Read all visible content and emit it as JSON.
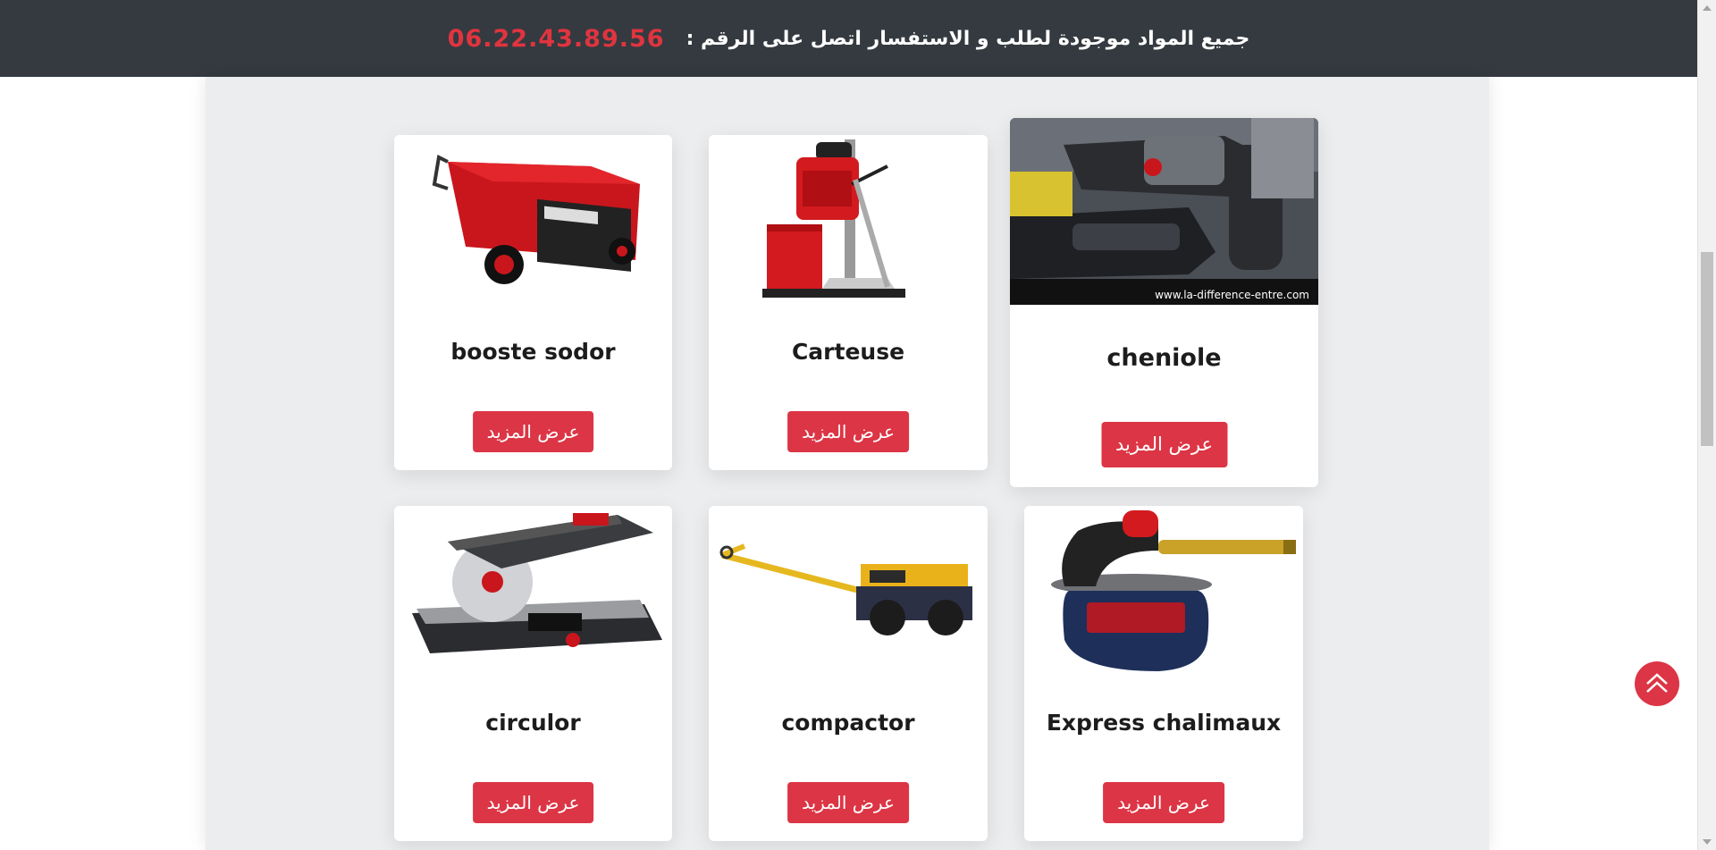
{
  "topbar": {
    "message": "جميع المواد موجودة لطلب و الاستفسار اتصل على الرقم :",
    "phone": "06.22.43.89.56"
  },
  "products": [
    {
      "title": "booste sodor",
      "button": "عرض المزيد",
      "image_icon": "welder-icon"
    },
    {
      "title": "Carteuse",
      "button": "عرض المزيد",
      "image_icon": "core-drill-icon"
    },
    {
      "title": "cheniole",
      "button": "عرض المزيد",
      "image_icon": "power-drills-photo",
      "image_watermark": "www.la-difference-entre.com"
    },
    {
      "title": "circulor",
      "button": "عرض المزيد",
      "image_icon": "miter-saw-icon"
    },
    {
      "title": "compactor",
      "button": "عرض المزيد",
      "image_icon": "roller-compactor-icon"
    },
    {
      "title": "Express chalimaux",
      "button": "عرض المزيد",
      "image_icon": "gas-torch-icon"
    }
  ],
  "colors": {
    "accent": "#dc3545",
    "topbar": "#343a40",
    "phone": "#e0343f",
    "content_bg": "#ecedef"
  }
}
